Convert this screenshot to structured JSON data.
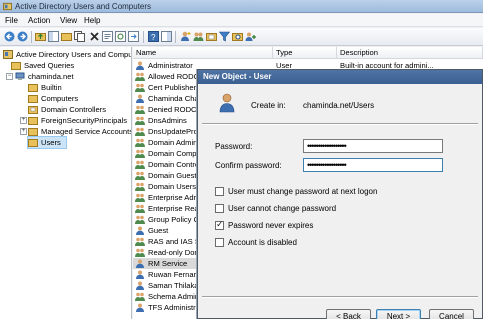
{
  "window": {
    "title": "Active Directory Users and Computers"
  },
  "menu": [
    "File",
    "Action",
    "View",
    "Help"
  ],
  "tree": {
    "root": "Active Directory Users and Comput",
    "items": [
      {
        "label": "Saved Queries"
      },
      {
        "label": "chaminda.net"
      },
      {
        "label": "Builtin"
      },
      {
        "label": "Computers"
      },
      {
        "label": "Domain Controllers"
      },
      {
        "label": "ForeignSecurityPrincipals"
      },
      {
        "label": "Managed Service Accounts"
      },
      {
        "label": "Users"
      }
    ]
  },
  "list": {
    "columns": [
      "Name",
      "Type",
      "Description"
    ],
    "rows": [
      {
        "name": "Administrator",
        "type": "User",
        "desc": "Built-in account for admini..."
      },
      {
        "name": "Allowed RODC Pa",
        "type": "",
        "desc": ""
      },
      {
        "name": "Cert Publishers",
        "type": "",
        "desc": ""
      },
      {
        "name": "Chaminda Chand",
        "type": "",
        "desc": ""
      },
      {
        "name": "Denied RODC Pa",
        "type": "",
        "desc": ""
      },
      {
        "name": "DnsAdmins",
        "type": "",
        "desc": ""
      },
      {
        "name": "DnsUpdateProxy",
        "type": "",
        "desc": ""
      },
      {
        "name": "Domain Admins",
        "type": "",
        "desc": ""
      },
      {
        "name": "Domain Compute",
        "type": "",
        "desc": ""
      },
      {
        "name": "Domain Controlle",
        "type": "",
        "desc": ""
      },
      {
        "name": "Domain Guests",
        "type": "",
        "desc": ""
      },
      {
        "name": "Domain Users",
        "type": "",
        "desc": ""
      },
      {
        "name": "Enterprise Admin",
        "type": "",
        "desc": ""
      },
      {
        "name": "Enterprise Read-",
        "type": "",
        "desc": ""
      },
      {
        "name": "Group Policy Cre",
        "type": "",
        "desc": ""
      },
      {
        "name": "Guest",
        "type": "",
        "desc": ""
      },
      {
        "name": "RAS and IAS Ser",
        "type": "",
        "desc": ""
      },
      {
        "name": "Read-only Doma",
        "type": "",
        "desc": ""
      },
      {
        "name": "RM Service",
        "type": "",
        "desc": ""
      },
      {
        "name": "Ruwan Fernando",
        "type": "",
        "desc": ""
      },
      {
        "name": "Saman Thilakara",
        "type": "",
        "desc": ""
      },
      {
        "name": "Schema Admins",
        "type": "",
        "desc": ""
      },
      {
        "name": "TFS Administrat",
        "type": "",
        "desc": ""
      }
    ]
  },
  "dialog": {
    "title": "New Object - User",
    "create_in_label": "Create in:",
    "create_in_value": "chaminda.net/Users",
    "password_label": "Password:",
    "password_value": "••••••••••••••••••",
    "confirm_label": "Confirm password:",
    "confirm_value": "••••••••••••••••••",
    "options": [
      {
        "label": "User must change password at next logon",
        "checked": false
      },
      {
        "label": "User cannot change password",
        "checked": false
      },
      {
        "label": "Password never expires",
        "checked": true
      },
      {
        "label": "Account is disabled",
        "checked": false
      }
    ],
    "buttons": {
      "back": "< Back",
      "next": "Next >",
      "cancel": "Cancel"
    }
  },
  "colors": {
    "accent": "#3a5f91",
    "selection": "#cce4f7",
    "folder": "#e8c15a"
  }
}
